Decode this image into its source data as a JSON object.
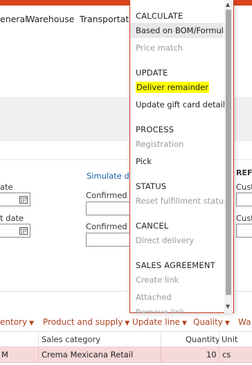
{
  "tabs": [
    "eneral",
    "Warehouse",
    "Transportatio"
  ],
  "form": {
    "col1_label_a": "ate",
    "col1_label_b": "t date",
    "simulate_link": "Simulate de",
    "confirmed_a": "Confirmed sh",
    "confirmed_b": "Confirmed re",
    "ref_head": "REFE",
    "ref_a": "Custo",
    "ref_b": "Custo"
  },
  "actions": [
    "entory",
    "Product and supply",
    "Update line",
    "Quality",
    "Wa"
  ],
  "table": {
    "headers": [
      "Sales category",
      "Quantity",
      "Unit"
    ],
    "row": {
      "col0": "M",
      "sales_category": "Crema Mexicana Retail",
      "quantity": "10",
      "unit": "cs"
    }
  },
  "menu": {
    "sections": [
      {
        "title": "CALCULATE",
        "items": [
          {
            "label": "Based on BOM/Formula",
            "state": "selected"
          },
          {
            "label": "Price match",
            "state": "disabled"
          }
        ]
      },
      {
        "title": "UPDATE",
        "items": [
          {
            "label": "Deliver remainder",
            "state": "highlight"
          },
          {
            "label": "Update gift card details",
            "state": "enabled"
          }
        ]
      },
      {
        "title": "PROCESS",
        "items": [
          {
            "label": "Registration",
            "state": "disabled"
          },
          {
            "label": "Pick",
            "state": "enabled"
          }
        ]
      },
      {
        "title": "STATUS",
        "items": [
          {
            "label": "Reset fulfillment status",
            "state": "disabled"
          }
        ]
      },
      {
        "title": "CANCEL",
        "items": [
          {
            "label": "Direct delivery",
            "state": "disabled"
          }
        ]
      },
      {
        "title": "SALES AGREEMENT",
        "items": [
          {
            "label": "Create link",
            "state": "disabled"
          },
          {
            "label": "Attached",
            "state": "disabled"
          },
          {
            "label": "Remove link",
            "state": "disabled"
          }
        ]
      }
    ]
  },
  "colors": {
    "accent": "#d9461e",
    "link": "#1a5fa8",
    "highlight": "#ffff00",
    "row_selected": "#f6d9d9"
  }
}
